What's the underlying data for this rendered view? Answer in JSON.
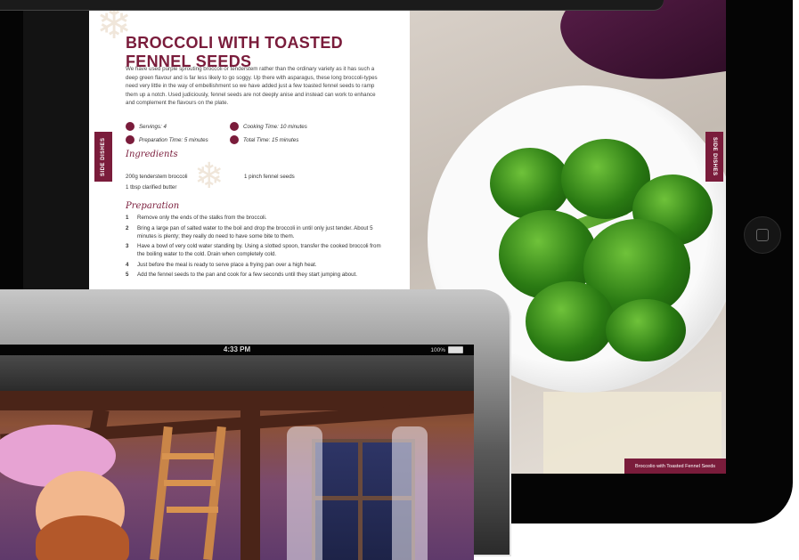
{
  "recipe": {
    "title": "BROCCOLI WITH TOASTED FENNEL SEEDS",
    "intro": "We have used purple sprouting broccoli or tenderstem rather than the ordinary variety as it has such a deep green flavour and is far less likely to go soggy. Up there with asparagus, these long broccoli-types need very little in the way of embellishment so we have added just a few toasted fennel seeds to ramp them up a notch. Used judiciously, fennel seeds are not deeply anise and instead can work to enhance and complement the flavours on the plate.",
    "servings": "Servings: 4",
    "cooking_time": "Cooking Time: 10 minutes",
    "prep_time": "Preparation Time: 5 minutes",
    "total_time": "Total Time: 15 minutes",
    "ingredients_heading": "Ingredients",
    "ingredients": [
      "200g tenderstem broccoli",
      "1 tbsp clarified butter",
      "1 pinch fennel seeds"
    ],
    "preparation_heading": "Preparation",
    "steps": [
      {
        "num": "1",
        "text": "Remove only the ends of the stalks from the broccoli."
      },
      {
        "num": "2",
        "text": "Bring a large pan of salted water to the boil and drop the broccoli in until only just tender. About 5 minutes is plenty; they really do need to have some bite to them."
      },
      {
        "num": "3",
        "text": "Have a bowl of very cold water standing by. Using a slotted spoon, transfer the cooked broccoli from the boiling water to the cold. Drain when completely cold."
      },
      {
        "num": "4",
        "text": "Just before the meal is ready to serve place a frying pan over a high heat."
      },
      {
        "num": "5",
        "text": "Add the fennel seeds to the pan and cook for a few seconds until they start jumping about."
      }
    ],
    "side_tab_left": "SIDE DISHES",
    "side_tab_right": "SIDE DISHES",
    "caption": "Broccolio with Toasted Fennel Seeds"
  },
  "front_tablet": {
    "time": "4:33 PM",
    "battery": "100%"
  },
  "colors": {
    "accent": "#7a1c3b"
  }
}
